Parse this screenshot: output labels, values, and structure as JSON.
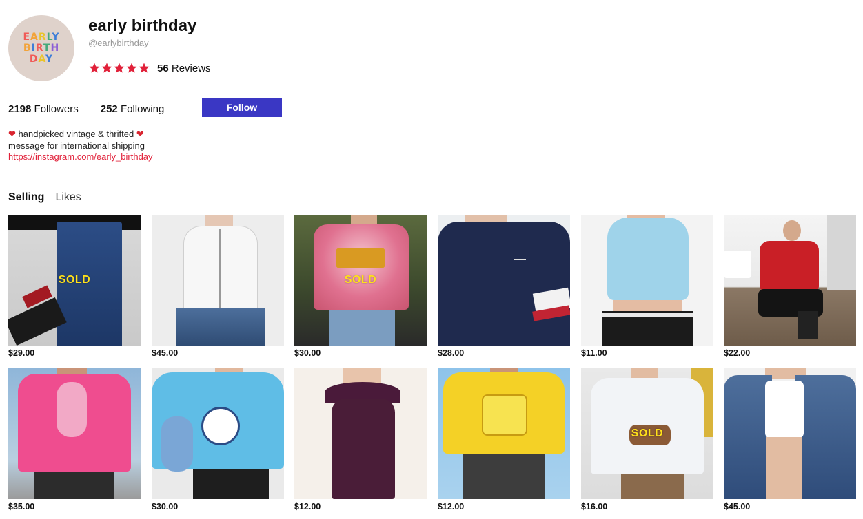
{
  "profile": {
    "avatar_lines": [
      "EARLY",
      "BIRTH",
      "DAY"
    ],
    "name": "early birthday",
    "handle": "@earlybirthday",
    "rating_stars": 5,
    "reviews_count": "56",
    "reviews_label": "Reviews",
    "followers_count": "2198",
    "followers_label": "Followers",
    "following_count": "252",
    "following_label": "Following",
    "follow_button": "Follow",
    "bio_line1": "handpicked vintage & thrifted",
    "bio_line2": "message for international shipping",
    "bio_link": "https://instagram.com/early_birthday"
  },
  "tabs": {
    "selling": "Selling",
    "likes": "Likes"
  },
  "colors": {
    "accent": "#3a37c4",
    "star": "#e1213a",
    "link": "#e1213a",
    "sold": "#ffe11a"
  },
  "listings": [
    {
      "price": "$29.00",
      "sold": "SOLD"
    },
    {
      "price": "$45.00",
      "sold": ""
    },
    {
      "price": "$30.00",
      "sold": "SOLD"
    },
    {
      "price": "$28.00",
      "sold": ""
    },
    {
      "price": "$11.00",
      "sold": ""
    },
    {
      "price": "$22.00",
      "sold": ""
    },
    {
      "price": "$35.00",
      "sold": ""
    },
    {
      "price": "$30.00",
      "sold": ""
    },
    {
      "price": "$12.00",
      "sold": ""
    },
    {
      "price": "$12.00",
      "sold": ""
    },
    {
      "price": "$16.00",
      "sold": "SOLD"
    },
    {
      "price": "$45.00",
      "sold": ""
    }
  ]
}
